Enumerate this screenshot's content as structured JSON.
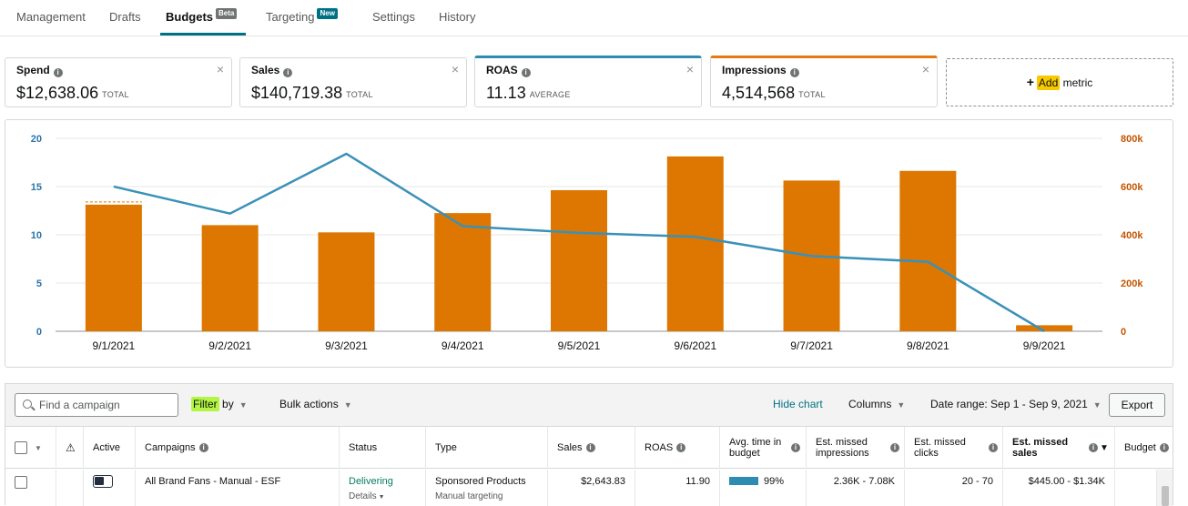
{
  "tabs": [
    {
      "label": "Management"
    },
    {
      "label": "Drafts"
    },
    {
      "label": "Budgets",
      "badge": "Beta"
    },
    {
      "label": "Targeting",
      "badge": "New"
    },
    {
      "label": "Settings"
    },
    {
      "label": "History"
    }
  ],
  "metrics": [
    {
      "label": "Spend",
      "value": "$12,638.06",
      "unit": "TOTAL"
    },
    {
      "label": "Sales",
      "value": "$140,719.38",
      "unit": "TOTAL"
    },
    {
      "label": "ROAS",
      "value": "11.13",
      "unit": "AVERAGE"
    },
    {
      "label": "Impressions",
      "value": "4,514,568",
      "unit": "TOTAL"
    }
  ],
  "add_metric": {
    "highlight": "Add",
    "rest": "metric"
  },
  "chart_data": {
    "type": "bar",
    "categories": [
      "9/1/2021",
      "9/2/2021",
      "9/3/2021",
      "9/4/2021",
      "9/5/2021",
      "9/6/2021",
      "9/7/2021",
      "9/8/2021",
      "9/9/2021"
    ],
    "series": [
      {
        "axis": "right",
        "type": "bar",
        "color": "#dd7701",
        "values": [
          525000,
          440000,
          410000,
          490000,
          585000,
          725000,
          625000,
          665000,
          25000
        ]
      },
      {
        "axis": "left",
        "type": "line",
        "color": "#3a91b8",
        "values": [
          15.0,
          12.2,
          18.4,
          10.9,
          10.2,
          9.8,
          7.8,
          7.2,
          0.0
        ]
      }
    ],
    "yleft": {
      "ticks": [
        "20",
        "15",
        "10",
        "5",
        "0"
      ],
      "lim": [
        0,
        20
      ],
      "color": "#2e75a8"
    },
    "yright": {
      "ticks": [
        "800k",
        "600k",
        "400k",
        "200k",
        "0"
      ],
      "lim": [
        0,
        800000
      ],
      "color": "#c45500"
    },
    "grid": true
  },
  "toolbar": {
    "search_placeholder": "Find a campaign",
    "filter_highlight": "Filter",
    "filter_rest": "by",
    "bulk_actions": "Bulk actions",
    "hide_chart": "Hide chart",
    "columns": "Columns",
    "date_range": "Date range: Sep 1 - Sep 9, 2021",
    "export": "Export"
  },
  "table": {
    "headers": {
      "active": "Active",
      "campaigns": "Campaigns",
      "status": "Status",
      "type": "Type",
      "sales": "Sales",
      "roas": "ROAS",
      "avg_time": "Avg. time in budget",
      "missed_impr": "Est. missed impressions",
      "missed_clicks": "Est. missed clicks",
      "missed_sales": "Est. missed sales",
      "budget": "Budget"
    },
    "rows": [
      {
        "campaign": "All Brand Fans - Manual - ESF",
        "status": "Delivering",
        "details": "Details",
        "type": "Sponsored Products",
        "type_sub": "Manual targeting",
        "sales": "$2,643.83",
        "roas": "11.90",
        "avg_time": "99%",
        "missed_impr": "2.36K - 7.08K",
        "missed_clicks": "20 - 70",
        "missed_sales": "$445.00 - $1.34K"
      }
    ]
  }
}
